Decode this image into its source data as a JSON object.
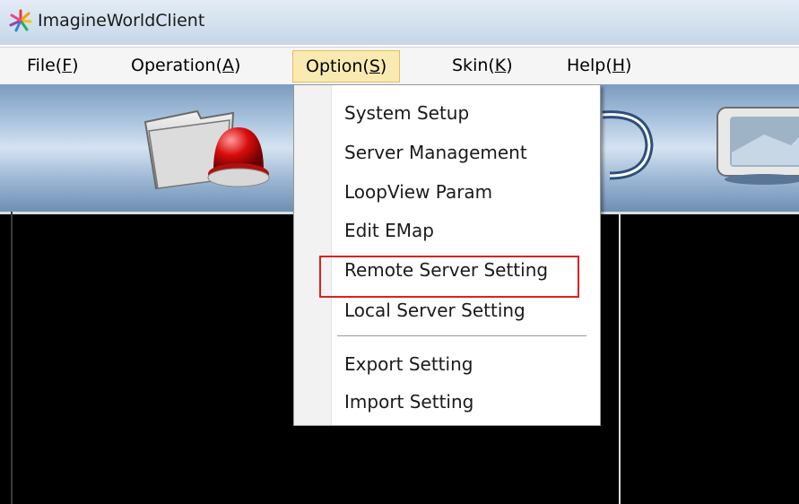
{
  "window": {
    "title": "ImagineWorldClient"
  },
  "menubar": {
    "items": [
      {
        "label": "File(",
        "mnemonic": "F",
        "close": ")"
      },
      {
        "label": "Operation(",
        "mnemonic": "A",
        "close": ")"
      },
      {
        "label": "Option(",
        "mnemonic": "S",
        "close": ")"
      },
      {
        "label": "Skin(",
        "mnemonic": "K",
        "close": ")"
      },
      {
        "label": "Help(",
        "mnemonic": "H",
        "close": ")"
      }
    ],
    "open_menu": "Option"
  },
  "option_menu": {
    "items": [
      "System Setup",
      "Server Management",
      "LoopView Param",
      "Edit EMap",
      "Remote Server Setting",
      "Local Server Setting",
      "Export Setting",
      "Import Setting"
    ],
    "highlighted": "Remote Server Setting"
  },
  "colors": {
    "highlight_border": "#e02020",
    "menu_active_bg": "#f8eab0",
    "video_bg": "#000000"
  },
  "icons": [
    "app-logo-icon",
    "folder-icon",
    "alarm-siren-icon",
    "refresh-arrow-icon",
    "monitor-screen-icon"
  ]
}
